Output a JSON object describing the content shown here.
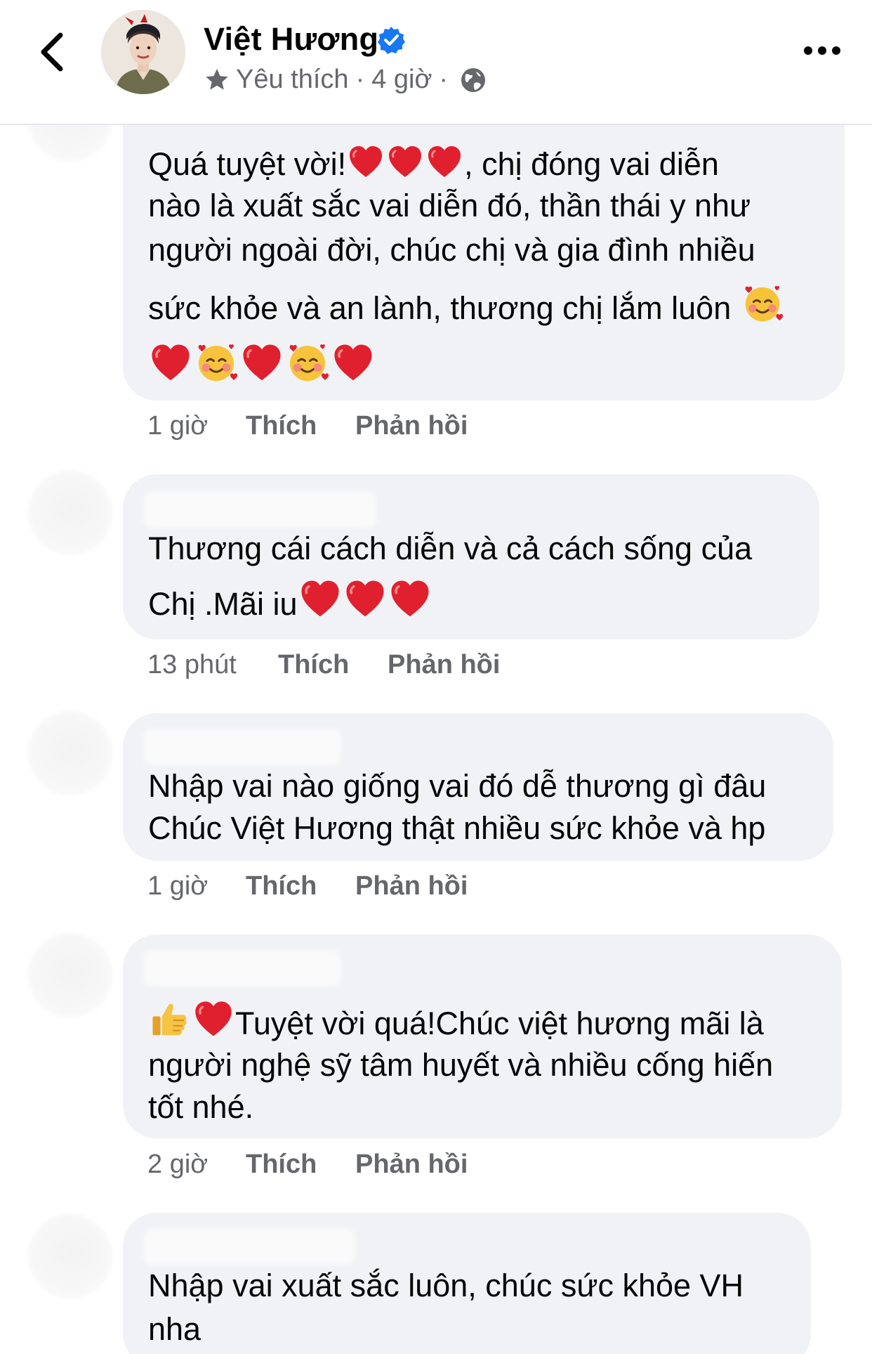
{
  "header": {
    "author": "Việt Hương",
    "meta_label": "Yêu thích",
    "meta_time": "4 giờ",
    "sep": "·"
  },
  "comments": [
    {
      "lines": [
        "Quá tuyệt vời!",
        ", chị đóng vai diễn",
        "nào là xuất sắc vai diễn đó, thần thái y như",
        "người ngoài đời, chúc chị và gia đình nhiều",
        "sức khỏe và an lành, thương chị lắm luôn"
      ],
      "time": "1 giờ",
      "like": "Thích",
      "reply": "Phản hồi"
    },
    {
      "lines": [
        "Thương cái cách diễn và cả cách sống của",
        "Chị .Mãi iu"
      ],
      "time": "13 phút",
      "like": "Thích",
      "reply": "Phản hồi"
    },
    {
      "lines": [
        "Nhập vai nào giống vai đó dễ thương gì đâu",
        "Chúc Việt Hương thật nhiều sức khỏe và hp"
      ],
      "time": "1 giờ",
      "like": "Thích",
      "reply": "Phản hồi"
    },
    {
      "lines": [
        "Tuyệt vời quá!Chúc việt hương mãi là",
        "người nghệ sỹ tâm huyết và nhiều cống hiến",
        "tốt nhé."
      ],
      "time": "2 giờ",
      "like": "Thích",
      "reply": "Phản hồi"
    },
    {
      "lines": [
        "Nhập vai xuất sắc luôn, chúc sức khỏe VH",
        "nha"
      ]
    }
  ],
  "icons": [
    "back-chevron-icon",
    "verified-badge-icon",
    "star-icon",
    "globe-icon",
    "more-options-icon",
    "red-heart-icon",
    "smiling-face-with-hearts-icon",
    "thumbs-up-icon"
  ],
  "colors": {
    "bubble": "#f0f2f5",
    "secondary_text": "#65676b",
    "verified": "#1877f2",
    "heart": "#e0202e"
  }
}
